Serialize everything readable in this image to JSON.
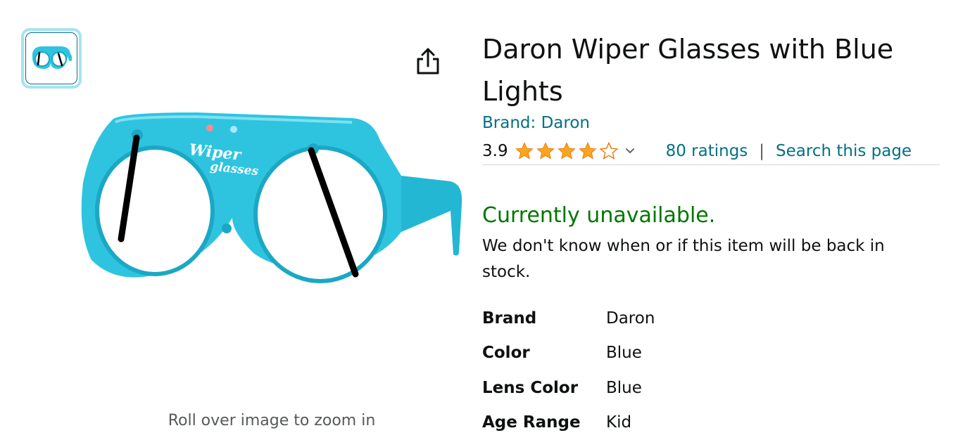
{
  "gallery": {
    "zoom_hint": "Roll over image to zoom in",
    "thumbnail_icon": "wiper-glasses-thumbnail",
    "main_image": {
      "icon": "wiper-glasses-photo",
      "printed_text_line1": "Wiper",
      "printed_text_line2": "glasses",
      "color": "#2ec4e0"
    },
    "share_icon": "share-icon"
  },
  "product": {
    "title": "Daron Wiper Glasses with Blue Lights",
    "brand_link": "Brand: Daron",
    "rating": {
      "value": "3.9",
      "stars_filled": 3.9,
      "stars_total": 5,
      "star_color": "#ffa41c",
      "count_label": "80 ratings",
      "separator": "|",
      "search_label": "Search this page"
    },
    "availability": {
      "status": "Currently unavailable.",
      "message": "We don't know when or if this item will be back in stock.",
      "status_color": "#007600"
    },
    "specs": [
      {
        "label": "Brand",
        "value": "Daron"
      },
      {
        "label": "Color",
        "value": "Blue"
      },
      {
        "label": "Lens Color",
        "value": "Blue"
      },
      {
        "label": "Age Range",
        "value": "Kid"
      }
    ]
  },
  "colors": {
    "link": "#007185",
    "thumb_border": "#a7e3f1"
  }
}
